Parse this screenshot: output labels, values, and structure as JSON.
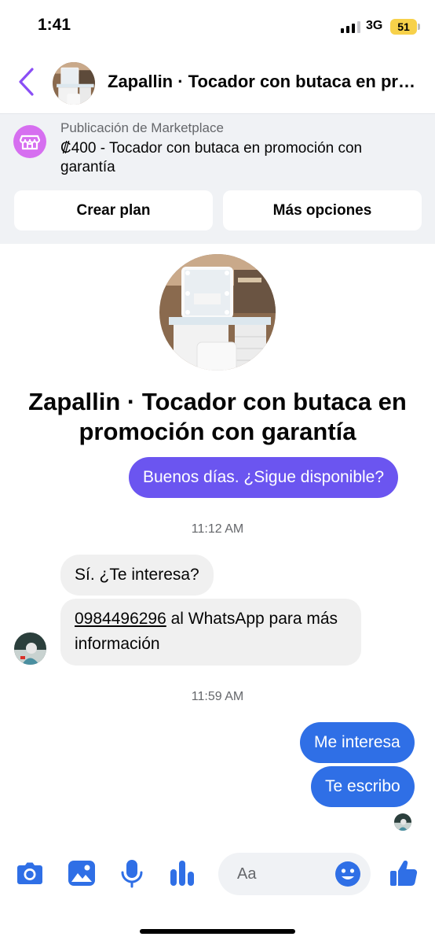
{
  "status_bar": {
    "time": "1:41",
    "network": "3G",
    "battery": "51"
  },
  "header": {
    "title": "Zapallin · Tocador con butaca en promoción con garantía"
  },
  "marketplace": {
    "kicker": "Publicación de Marketplace",
    "description": "₡400 - Tocador con butaca en promoción con garantía",
    "create_plan_label": "Crear plan",
    "more_options_label": "Más opciones"
  },
  "product": {
    "title": "Zapallin · Tocador con butaca en promoción con garantía"
  },
  "messages": [
    {
      "text": "Buenos días. ¿Sigue disponible?"
    },
    {
      "time": "11:12 AM"
    },
    {
      "text": "Sí. ¿Te interesa?"
    },
    {
      "phone": "0984496296",
      "text": " al WhatsApp para más información"
    },
    {
      "time": "11:59 AM"
    },
    {
      "text": "Me interesa"
    },
    {
      "text": "Te escribo"
    }
  ],
  "composer": {
    "placeholder": "Aa"
  },
  "colors": {
    "accent": "#2f6fe6",
    "first_outgoing": "#6b55f0",
    "back_chevron": "#8a4ef5",
    "marketplace_icon": "#d66ff0",
    "battery": "#f7d14a"
  },
  "icons": [
    "back-chevron-icon",
    "marketplace-icon",
    "camera-icon",
    "image-icon",
    "microphone-icon",
    "more-options-icon",
    "emoji-icon",
    "thumbs-up-icon"
  ]
}
